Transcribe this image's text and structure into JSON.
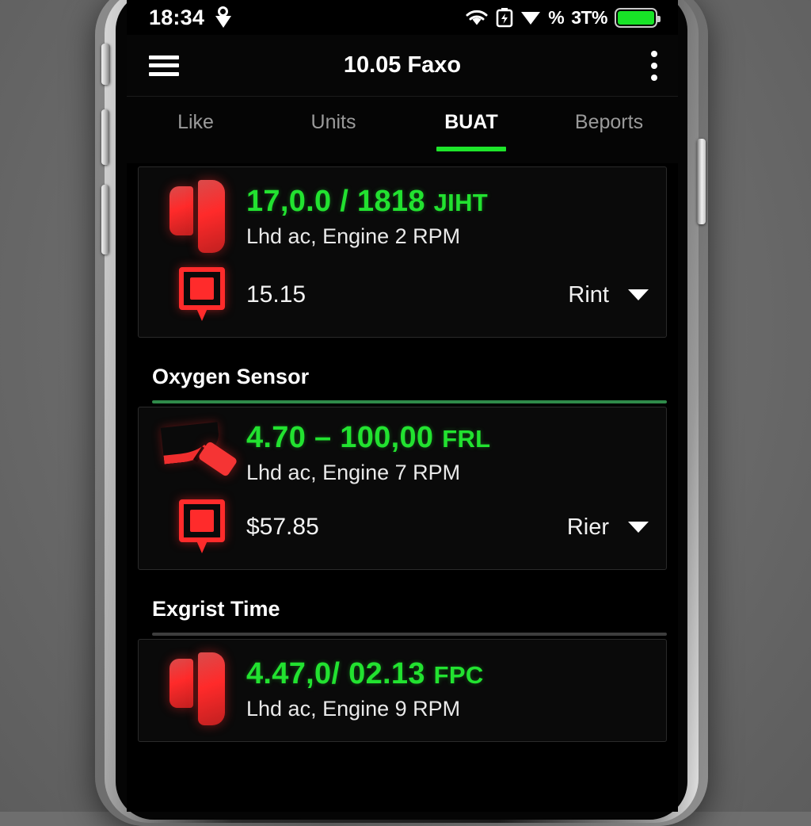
{
  "status_bar": {
    "clock": "18:34",
    "location_icon": "location-pin-icon",
    "wifi_icon": "wifi-icon",
    "battery_charge_icon": "battery-charging-icon",
    "signal_icon": "signal-triangle-icon",
    "percent_symbol": "%",
    "battery_percent": "3T%",
    "battery_level_icon": "battery-full-icon"
  },
  "app_bar": {
    "menu_icon": "hamburger-menu-icon",
    "title": "10.05 Faxo",
    "overflow_icon": "three-dot-overflow-icon"
  },
  "tabs": [
    {
      "label": "Like",
      "active": false
    },
    {
      "label": "Units",
      "active": false
    },
    {
      "label": "BUAT",
      "active": true
    },
    {
      "label": "Beports",
      "active": false
    }
  ],
  "cards": [
    {
      "icon": "brake-pads-icon",
      "value": "17,0.0 / 1818",
      "unit": "JIHT",
      "subtitle": "Lhd ac, Engine 2 RPM",
      "detail_icon": "tag-marker-icon",
      "detail_value": "15.15",
      "detail_label": "Rint",
      "detail_caret": "chevron-down-icon"
    },
    {
      "icon": "oxygen-probe-icon",
      "value": "4.70 – 100,00",
      "unit": "FRL",
      "subtitle": "Lhd ac, Engine 7 RPM",
      "detail_icon": "tag-marker-icon",
      "detail_value": "$57.85",
      "detail_label": "Rier",
      "detail_caret": "chevron-down-icon"
    },
    {
      "icon": "brake-pads-icon",
      "value": "4.47,0/ 02.13",
      "unit": "FPC",
      "subtitle": "Lhd ac, Engine 9 RPM"
    }
  ],
  "sections": [
    {
      "title": "Oxygen Sensor",
      "rule": "green"
    },
    {
      "title": "Exgrist Time",
      "rule": "grey"
    }
  ],
  "colors": {
    "accent_green": "#1ee52b",
    "value_green": "#22e230",
    "icon_red": "#ff2b2b",
    "screen_bg": "#000000",
    "card_bg": "#0a0a0a",
    "card_border": "#2a2a2a",
    "inactive_tab": "#9a9a9a"
  }
}
